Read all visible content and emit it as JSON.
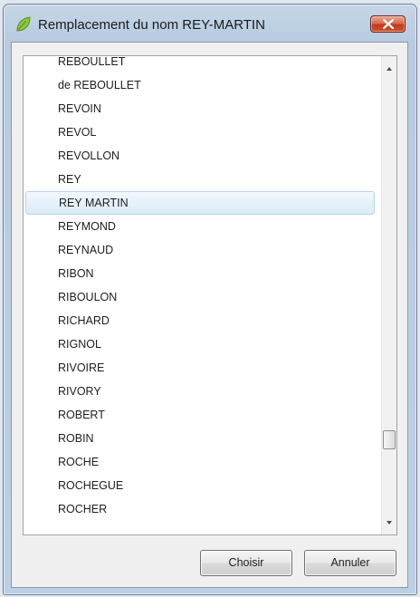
{
  "window": {
    "title": "Remplacement du nom REY-MARTIN",
    "icon": "leaf-icon",
    "close_icon": "close-icon"
  },
  "list": {
    "selected_index": 7,
    "items": [
      "REBOULLET",
      "de REBOULLET",
      "REVOIN",
      "REVOL",
      "REVOLLON",
      "REY",
      "REY MARTIN",
      "REYMOND",
      "REYNAUD",
      "RIBON",
      "RIBOULON",
      "RICHARD",
      "RIGNOL",
      "RIVOIRE",
      "RIVORY",
      "ROBERT",
      "ROBIN",
      "ROCHE",
      "ROCHEGUE",
      "ROCHER"
    ]
  },
  "buttons": {
    "choose": "Choisir",
    "cancel": "Annuler"
  }
}
